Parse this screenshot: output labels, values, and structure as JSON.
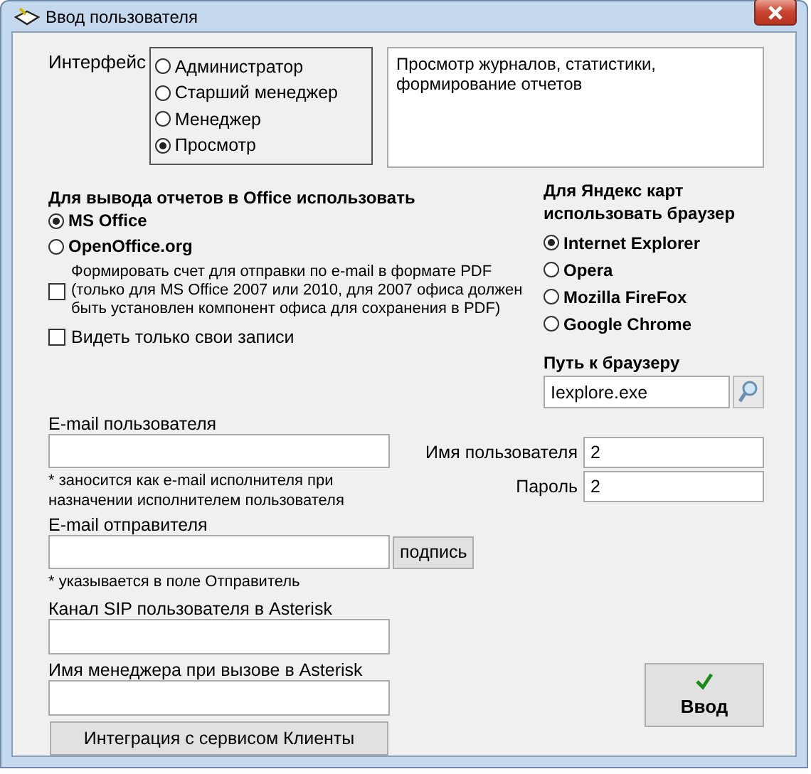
{
  "window": {
    "title": "Ввод пользователя"
  },
  "interface": {
    "label": "Интерфейс",
    "options": [
      {
        "label": "Администратор",
        "selected": false
      },
      {
        "label": "Старший менеджер",
        "selected": false
      },
      {
        "label": "Менеджер",
        "selected": false
      },
      {
        "label": "Просмотр",
        "selected": true
      }
    ],
    "description": "Просмотр журналов, статистики, формирование отчетов"
  },
  "office": {
    "heading": "Для вывода отчетов в Office использовать",
    "options": [
      {
        "label": "MS Office",
        "selected": true
      },
      {
        "label": "OpenOffice.org",
        "selected": false
      }
    ],
    "checkboxes": [
      {
        "kind": "note",
        "label": "Формировать счет для отправки по e-mail в формате PDF\n(только для MS Office 2007 или 2010, для 2007 офиса должен\nбыть установлен компонент офиса для  сохранения в PDF)",
        "checked": false
      },
      {
        "kind": "plain",
        "label": "Видеть только свои записи",
        "checked": false
      }
    ]
  },
  "browser": {
    "heading": "Для Яндекс карт использовать браузер",
    "options": [
      {
        "label": "Internet Explorer",
        "selected": true
      },
      {
        "label": "Opera",
        "selected": false
      },
      {
        "label": "Mozilla FireFox",
        "selected": false
      },
      {
        "label": "Google Chrome",
        "selected": false
      }
    ],
    "path_label": "Путь к браузеру",
    "path_value": "Iexplore.exe"
  },
  "email_user": {
    "label": "E-mail пользователя",
    "note": "* заносится как e-mail исполнителя при\nназначении исполнителем пользователя"
  },
  "email_sender": {
    "label": "E-mail отправителя",
    "button": "подпись",
    "note": "* указывается в поле Отправитель"
  },
  "sip": {
    "label": "Канал SIP пользователя в Asterisk"
  },
  "manager_name": {
    "label": "Имя менеджера при вызове в Asterisk"
  },
  "integration_button": "Интеграция с сервисом Клиенты",
  "credentials": [
    {
      "label": "Имя пользователя",
      "value": "2"
    },
    {
      "label": "Пароль",
      "value": "2"
    }
  ],
  "submit_button": "Ввод"
}
